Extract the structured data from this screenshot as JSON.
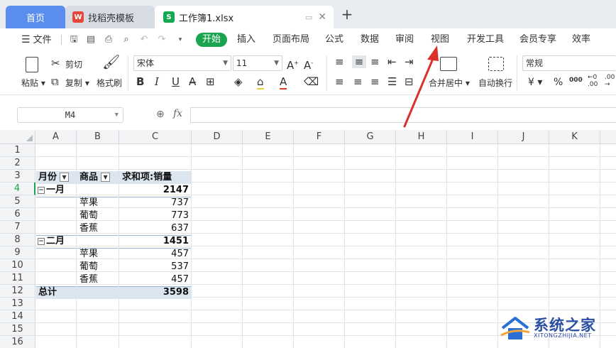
{
  "tabs": {
    "home": "首页",
    "template": "找稻壳模板",
    "template_icon": "W",
    "workbook": "工作簿1.xlsx",
    "workbook_icon": "S",
    "add": "+"
  },
  "menu": {
    "file": "文件",
    "items": [
      "开始",
      "插入",
      "页面布局",
      "公式",
      "数据",
      "审阅",
      "视图",
      "开发工具",
      "会员专享",
      "效率"
    ]
  },
  "toolbar": {
    "paste": "粘贴",
    "cut": "剪切",
    "copy": "复制",
    "format_painter": "格式刷",
    "font_name": "宋体",
    "font_size": "11",
    "merge_center": "合并居中",
    "wrap_text": "自动换行",
    "number_format": "常规",
    "currency": "¥",
    "percent": "%",
    "thousands": "000"
  },
  "formula_bar": {
    "name_box": "M4",
    "fx": "fx",
    "formula": ""
  },
  "columns": [
    "A",
    "B",
    "C",
    "D",
    "E",
    "F",
    "G",
    "H",
    "I",
    "J",
    "K"
  ],
  "rows": [
    "1",
    "2",
    "3",
    "4",
    "5",
    "6",
    "7",
    "8",
    "9",
    "10",
    "11",
    "12",
    "13",
    "14",
    "15",
    "16"
  ],
  "pivot": {
    "header_month": "月份",
    "header_product": "商品",
    "header_value": "求和项:销量",
    "group1_label": "一月",
    "group1_total": "2147",
    "group1_items": [
      {
        "name": "苹果",
        "value": "737"
      },
      {
        "name": "葡萄",
        "value": "773"
      },
      {
        "name": "香蕉",
        "value": "637"
      }
    ],
    "group2_label": "二月",
    "group2_total": "1451",
    "group2_items": [
      {
        "name": "苹果",
        "value": "457"
      },
      {
        "name": "葡萄",
        "value": "537"
      },
      {
        "name": "香蕉",
        "value": "457"
      }
    ],
    "grand_total_label": "总计",
    "grand_total": "3598"
  },
  "watermark": {
    "title": "系统之家",
    "subtitle": "XITONGZHIJIA.NET"
  },
  "colors": {
    "accent_green": "#1aa44f",
    "home_tab": "#5b8def",
    "pivot_band": "#dce6f1",
    "arrow_red": "#d9322b"
  }
}
